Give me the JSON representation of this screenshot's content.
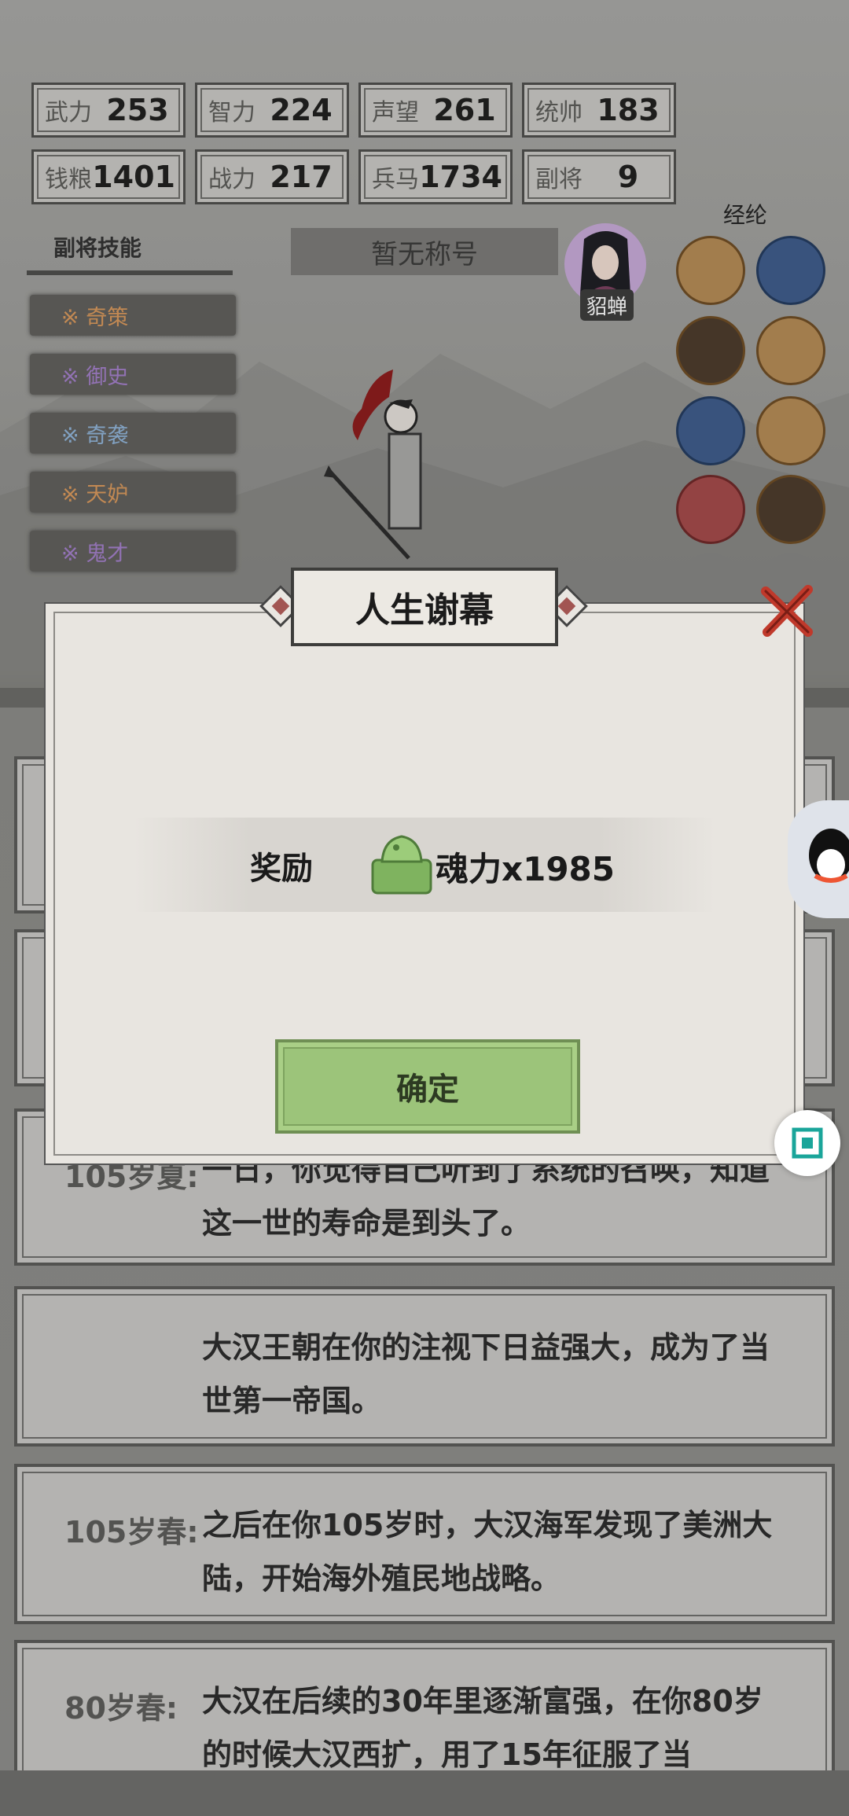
{
  "stats": [
    {
      "label": "武力",
      "value": "253"
    },
    {
      "label": "智力",
      "value": "224"
    },
    {
      "label": "声望",
      "value": "261"
    },
    {
      "label": "统帅",
      "value": "183"
    },
    {
      "label": "钱粮",
      "value": "1401"
    },
    {
      "label": "战力",
      "value": "217"
    },
    {
      "label": "兵马",
      "value": "1734"
    },
    {
      "label": "副将",
      "value": "9"
    }
  ],
  "skills_title": "副将技能",
  "skills": [
    {
      "label": "※ 奇策",
      "color": "#d9985a"
    },
    {
      "label": "※ 御史",
      "color": "#a27ec9"
    },
    {
      "label": "※ 奇袭",
      "color": "#8fb3d8"
    },
    {
      "label": "※ 天妒",
      "color": "#d9985a"
    },
    {
      "label": "※ 鬼才",
      "color": "#a27ec9"
    }
  ],
  "player_title": "暂无称号",
  "companion_name": "貂蝉",
  "jinglun_title": "经纶",
  "events": [
    {
      "age": "105岁夏:",
      "text": "一日，你觉得自己听到了系统的召唤，知道这一世的寿命是到头了。"
    },
    {
      "age": "",
      "text": "大汉王朝在你的注视下日益强大，成为了当世第一帝国。"
    },
    {
      "age": "105岁春:",
      "text": "之后在你105岁时，大汉海军发现了美洲大陆，开始海外殖民地战略。"
    },
    {
      "age": "80岁春:",
      "text": "大汉在后续的30年里逐渐富强，在你80岁的时候大汉西扩，用了15年征服了当"
    }
  ],
  "modal": {
    "title": "人生谢幕",
    "reward_label": "奖励",
    "reward_value": "魂力x1985",
    "confirm_label": "确定"
  },
  "colors": {
    "confirm": "#9cc47a",
    "close": "#c0392b"
  }
}
